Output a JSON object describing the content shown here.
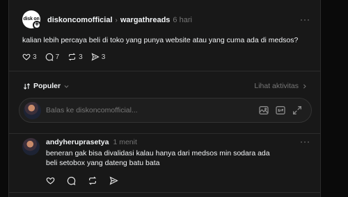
{
  "post": {
    "avatar_text": "disk on",
    "username": "diskoncomofficial",
    "breadcrumb_sep": "›",
    "topic": "wargathreads",
    "time": "6 hari",
    "more": "···",
    "text": "kalian lebih percaya beli di toko yang punya website atau yang cuma ada di medsos?",
    "likes": "3",
    "comments": "7",
    "reposts": "3",
    "shares": "3"
  },
  "sort": {
    "label": "Populer",
    "activity_label": "Lihat aktivitas"
  },
  "reply_box": {
    "placeholder": "Balas ke diskoncomofficial..."
  },
  "comment": {
    "username": "andyheruprasetya",
    "time": "1 menit",
    "more": "···",
    "text": "beneran gak bisa divalidasi kalau hanya dari medsos min sodara ada beli setobox yang dateng batu bata"
  },
  "icons": {
    "like": "heart-icon",
    "comment": "comment-icon",
    "repost": "repost-icon",
    "share": "send-icon",
    "sort": "sort-icon",
    "chevron": "chevron-down-icon",
    "activity_chevron": "chevron-right-icon",
    "image": "image-icon",
    "gif": "gif-icon",
    "expand": "expand-icon"
  },
  "colors": {
    "background": "#181818",
    "text": "#f3f5f7",
    "muted": "#777777",
    "border": "#2d2d2d"
  }
}
